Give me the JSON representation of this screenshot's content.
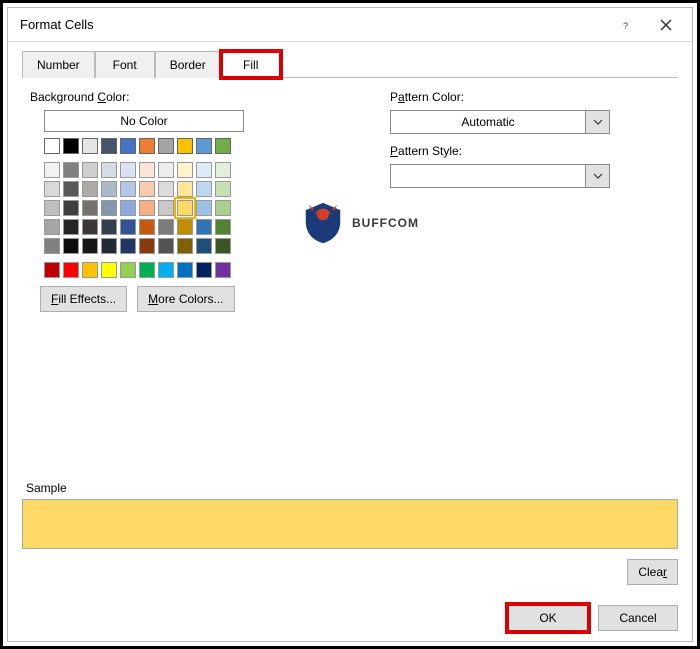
{
  "title": "Format Cells",
  "tabs": [
    "Number",
    "Font",
    "Border",
    "Fill"
  ],
  "active_tab": "Fill",
  "labels": {
    "bg": "Background",
    "bg_accel": "C",
    "bg_suffix": "olor:",
    "nocolor": "No Color",
    "pat_color": "P",
    "pat_color_accel": "a",
    "pat_color_rest": "ttern Color:",
    "auto": "Automatic",
    "pat_style_accel": "P",
    "pat_style_rest": "attern Style:",
    "fill_eff_pre": "Fill Effects",
    "fill_eff_accel": "...",
    "more_colors_accel": "M",
    "more_colors_rest": "ore Colors...",
    "sample": "Sample",
    "clear": "Clea",
    "clear_accel": "r",
    "ok": "OK",
    "cancel": "Cancel"
  },
  "colors": {
    "top_row": [
      "#ffffff",
      "#000000",
      "#e7e6e6",
      "#44546a",
      "#4472c4",
      "#ed7d31",
      "#a5a5a5",
      "#ffc000",
      "#5b9bd5",
      "#70ad47"
    ],
    "shades": [
      [
        "#f2f2f2",
        "#808080",
        "#d0cece",
        "#d6dce4",
        "#d9e1f2",
        "#fce4d6",
        "#ededed",
        "#fff2cc",
        "#ddebf7",
        "#e2efda"
      ],
      [
        "#d9d9d9",
        "#595959",
        "#aeaaaa",
        "#acb9ca",
        "#b4c6e7",
        "#f8cbad",
        "#dbdbdb",
        "#ffe699",
        "#bdd7ee",
        "#c6e0b4"
      ],
      [
        "#bfbfbf",
        "#404040",
        "#757171",
        "#8497b0",
        "#8ea9db",
        "#f4b084",
        "#c9c9c9",
        "#ffd966",
        "#9bc2e6",
        "#a9d08e"
      ],
      [
        "#a6a6a6",
        "#262626",
        "#3a3838",
        "#333f4f",
        "#305496",
        "#c65911",
        "#7b7b7b",
        "#bf8f00",
        "#2f75b5",
        "#548235"
      ],
      [
        "#808080",
        "#0d0d0d",
        "#161616",
        "#222b35",
        "#203764",
        "#833c0c",
        "#525252",
        "#806000",
        "#1f4e78",
        "#375623"
      ]
    ],
    "standard": [
      "#c00000",
      "#ff0000",
      "#ffc000",
      "#ffff00",
      "#92d050",
      "#00b050",
      "#00b0f0",
      "#0070c0",
      "#002060",
      "#7030a0"
    ],
    "selected": "#ffd966",
    "sample_fill": "#ffd966"
  },
  "buff": "BUFFCOM"
}
